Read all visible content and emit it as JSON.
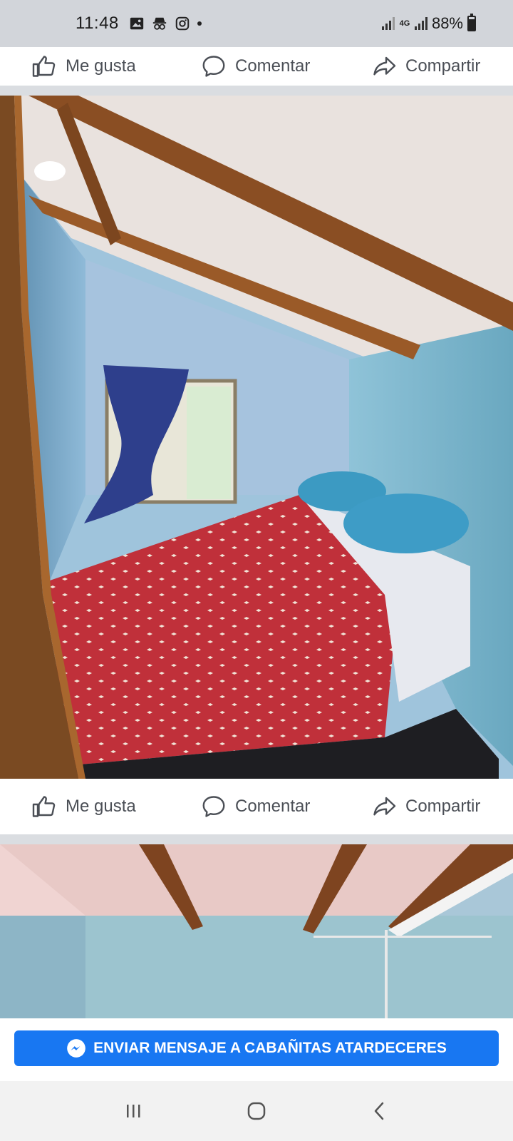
{
  "status_bar": {
    "time": "11:48",
    "network": "4G",
    "battery": "88%",
    "icons": [
      "gallery-icon",
      "incognito-icon",
      "instagram-icon",
      "notification-dot-icon",
      "signal-icon",
      "network-4g-icon",
      "battery-icon"
    ]
  },
  "post_actions_top": {
    "like_label": "Me gusta",
    "comment_label": "Comentar",
    "share_label": "Compartir"
  },
  "post_actions_mid": {
    "like_label": "Me gusta",
    "comment_label": "Comentar",
    "share_label": "Compartir"
  },
  "message_button": {
    "label": "ENVIAR MENSAJE A CABAÑITAS ATARDECERES",
    "icon": "messenger-icon",
    "color": "#1877f2"
  },
  "nav_bar": {
    "icons": [
      "recent-apps-icon",
      "home-icon",
      "back-icon"
    ]
  },
  "colors": {
    "action_text": "#4b4f56",
    "status_bar_bg": "#d2d5da"
  }
}
